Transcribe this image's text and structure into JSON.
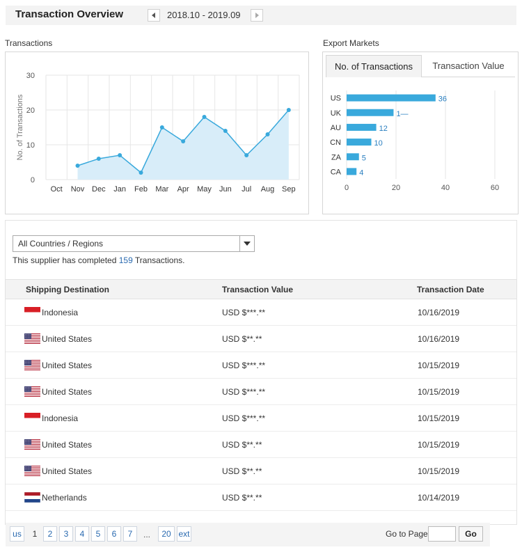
{
  "header": {
    "title": "Transaction Overview",
    "date_range": "2018.10 - 2019.09"
  },
  "transactions_panel": {
    "label": "Transactions"
  },
  "markets_panel": {
    "label": "Export Markets",
    "tabs": [
      {
        "label": "No. of Transactions",
        "active": true
      },
      {
        "label": "Transaction Value",
        "active": false
      }
    ]
  },
  "chart_data": [
    {
      "type": "area",
      "title": "",
      "xlabel": "",
      "ylabel": "No. of Transactions",
      "categories": [
        "Oct",
        "Nov",
        "Dec",
        "Jan",
        "Feb",
        "Mar",
        "Apr",
        "May",
        "Jun",
        "Jul",
        "Aug",
        "Sep"
      ],
      "values": [
        null,
        4,
        6,
        7,
        2,
        15,
        11,
        18,
        14,
        7,
        13,
        20
      ],
      "ylim": [
        0,
        30
      ],
      "yticks": [
        0,
        10,
        20,
        30
      ],
      "grid": true,
      "color": "#39a9dc",
      "fill": "#d8edf9"
    },
    {
      "type": "bar",
      "orientation": "horizontal",
      "categories": [
        "US",
        "UK",
        "AU",
        "CN",
        "ZA",
        "CA"
      ],
      "values": [
        36,
        19,
        12,
        10,
        5,
        4
      ],
      "value_labels": [
        "36",
        "1—",
        "12",
        "10",
        "5",
        "4"
      ],
      "xlim": [
        0,
        60
      ],
      "xticks": [
        0,
        20,
        40,
        60
      ],
      "grid": true,
      "color": "#39a9dc"
    }
  ],
  "filter": {
    "selected": "All Countries / Regions"
  },
  "summary": {
    "prefix": "This supplier has completed ",
    "count": "159",
    "suffix": " Transactions."
  },
  "table": {
    "columns": [
      "Shipping Destination",
      "Transaction Value",
      "Transaction Date"
    ],
    "rows": [
      {
        "flag": "indonesia",
        "country": "Indonesia",
        "value": "USD $***.**",
        "date": "10/16/2019"
      },
      {
        "flag": "united-states",
        "country": "United States",
        "value": "USD $**.**",
        "date": "10/16/2019"
      },
      {
        "flag": "united-states",
        "country": "United States",
        "value": "USD $***.**",
        "date": "10/15/2019"
      },
      {
        "flag": "united-states",
        "country": "United States",
        "value": "USD $***.**",
        "date": "10/15/2019"
      },
      {
        "flag": "indonesia",
        "country": "Indonesia",
        "value": "USD $***.**",
        "date": "10/15/2019"
      },
      {
        "flag": "united-states",
        "country": "United States",
        "value": "USD $**.**",
        "date": "10/15/2019"
      },
      {
        "flag": "united-states",
        "country": "United States",
        "value": "USD $**.**",
        "date": "10/15/2019"
      },
      {
        "flag": "netherlands",
        "country": "Netherlands",
        "value": "USD $**.**",
        "date": "10/14/2019"
      }
    ]
  },
  "pagination": {
    "prev_label": "us",
    "pages": [
      "1",
      "2",
      "3",
      "4",
      "5",
      "6",
      "7"
    ],
    "current": "1",
    "ellipsis": "...",
    "last": "20",
    "next_label": "ext",
    "goto_label": "Go to Page",
    "go_label": "Go"
  }
}
